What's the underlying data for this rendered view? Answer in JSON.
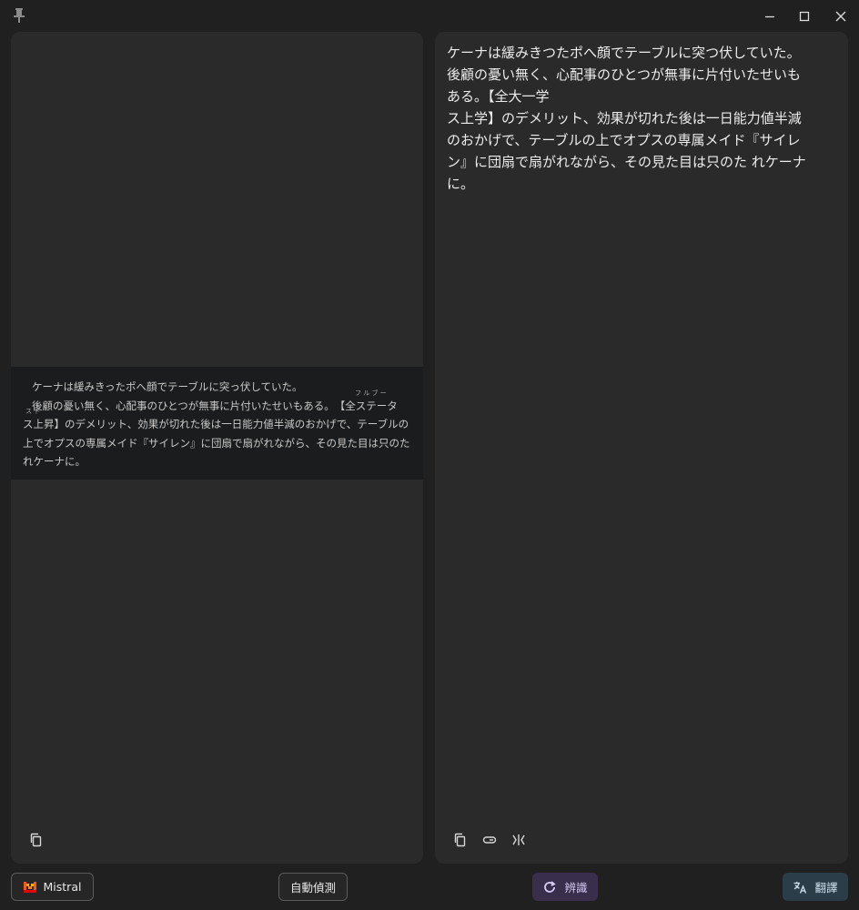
{
  "window": {
    "pin_icon": "pin-icon",
    "minimize_icon": "minimize-icon",
    "maximize_icon": "maximize-icon",
    "close_icon": "close-icon"
  },
  "source_panel": {
    "lines": [
      "ケーナは緩みきったポへ顔でテーブルに突っ伏していた。",
      "後顧の憂い無く、心配事のひとつが無事に片付いたせいもある。　【全ステータ",
      "ス上昇】のデメリット、効果が切れた後は一日能力値半減のおかげで、テーブルの",
      "上でオプスの専属メイド『サイレン』に団扇で扇がれながら、その見た目は只のた",
      "れケーナに。"
    ],
    "ruby_full": "フ ル ブ ー",
    "ruby_up": "ス ト",
    "copy_icon": "copy-icon"
  },
  "translation_panel": {
    "lines": [
      "ケーナは緩みきつたポへ顔でテーブルに突つ伏していた。",
      "後顧の憂い無く、心配事のひとつが無事に片付いたせいも",
      "ある。【全大一学",
      "ス上学】のデメリット、効果が切れた後は一日能力値半減",
      "のおかげで、テーブルの上でオプスの専属メイド『サイレ",
      "ン』に団扇で扇がれながら、その見た目は只のた れケーナ",
      "に。"
    ],
    "copy_icon": "copy-icon",
    "link_icon": "link-icon",
    "compare_icon": "compare-icon"
  },
  "bottom_bar": {
    "model_label": "Mistral",
    "model_icon": "mistral-logo-icon",
    "language_label": "自動偵測",
    "recognize_label": "辨識",
    "recognize_icon": "refresh-icon",
    "translate_label": "翻譯",
    "translate_icon": "translate-icon"
  }
}
